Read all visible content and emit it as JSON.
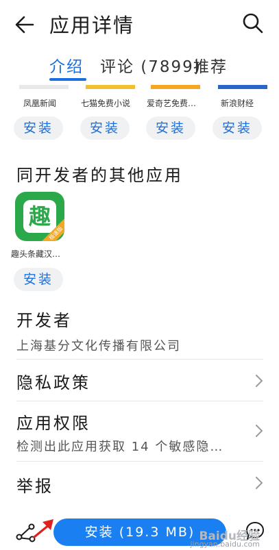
{
  "header": {
    "title": "应用详情"
  },
  "tabs": [
    {
      "label": "介绍",
      "active": true
    },
    {
      "label": "评论 (7899)",
      "active": false
    },
    {
      "label": "推荐",
      "active": false
    }
  ],
  "apps": [
    {
      "name": "凤凰新闻",
      "install": "安装"
    },
    {
      "name": "七猫免费小说",
      "install": "安装"
    },
    {
      "name": "爱奇艺免费…",
      "install": "安装"
    },
    {
      "name": "新浪财经",
      "install": "安装"
    }
  ],
  "same_developer": {
    "title": "同开发者的其他应用",
    "app": {
      "icon_char": "趣",
      "badge": "极速版",
      "name": "趣头条藏汉…",
      "install": "安装"
    }
  },
  "developer": {
    "label": "开发者",
    "name": "上海基分文化传播有限公司"
  },
  "rows": {
    "privacy": {
      "label": "隐私政策"
    },
    "permissions": {
      "label": "应用权限",
      "sub": "检测出此应用获取 14 个敏感隐…"
    },
    "report": {
      "label": "举报"
    }
  },
  "bottom": {
    "install_label": "安装 (19.3 MB)"
  },
  "watermark": {
    "line1": "Baidu经验",
    "line2": "jingyan.baidu.com"
  },
  "colors": {
    "accent": "#1a6fde",
    "install_bg": "#1a7ff0",
    "annotation": "#e0201c"
  }
}
